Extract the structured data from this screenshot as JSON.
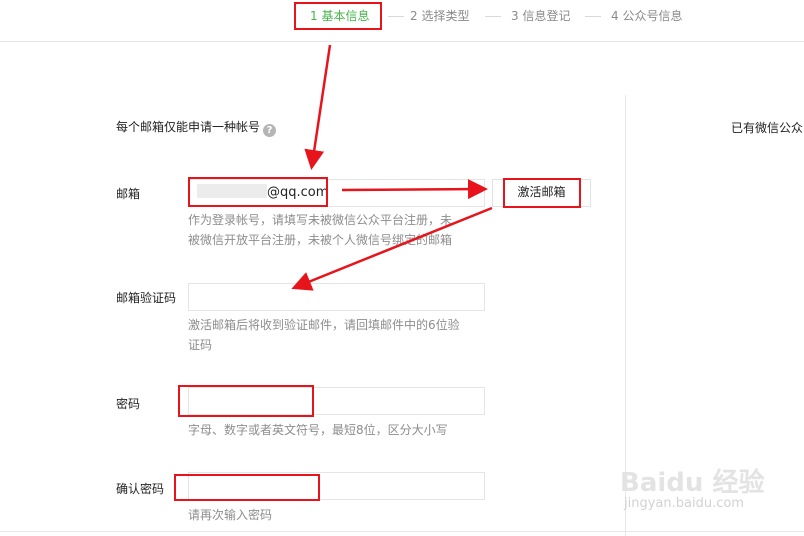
{
  "steps": [
    {
      "label": "1 基本信息"
    },
    {
      "label": "2 选择类型"
    },
    {
      "label": "3 信息登记"
    },
    {
      "label": "4 公众号信息"
    }
  ],
  "form": {
    "notice": "每个邮箱仅能申请一种帐号",
    "help_icon_glyph": "?",
    "email": {
      "label": "邮箱",
      "value": "@qq.com",
      "hint_line1": "作为登录帐号，请填写未被微信公众平台注册，未",
      "hint_line2": "被微信开放平台注册，未被个人微信号绑定的邮箱",
      "activate_button": "激活邮箱"
    },
    "code": {
      "label": "邮箱验证码",
      "value": "",
      "hint_line1": "激活邮箱后将收到验证邮件，请回填邮件中的6位验",
      "hint_line2": "证码"
    },
    "password": {
      "label": "密码",
      "value": "",
      "hint": "字母、数字或者英文符号，最短8位，区分大小写"
    },
    "confirm": {
      "label": "确认密码",
      "value": "",
      "hint": "请再次输入密码"
    }
  },
  "sidebar": {
    "text": "已有微信公众"
  },
  "watermark": {
    "logo": "Baidu 经验",
    "url": "jingyan.baidu.com"
  },
  "colors": {
    "active_step": "#44b549",
    "annotation_red": "#e8141b"
  },
  "icons": [
    "help-icon",
    "arrow-icon"
  ]
}
